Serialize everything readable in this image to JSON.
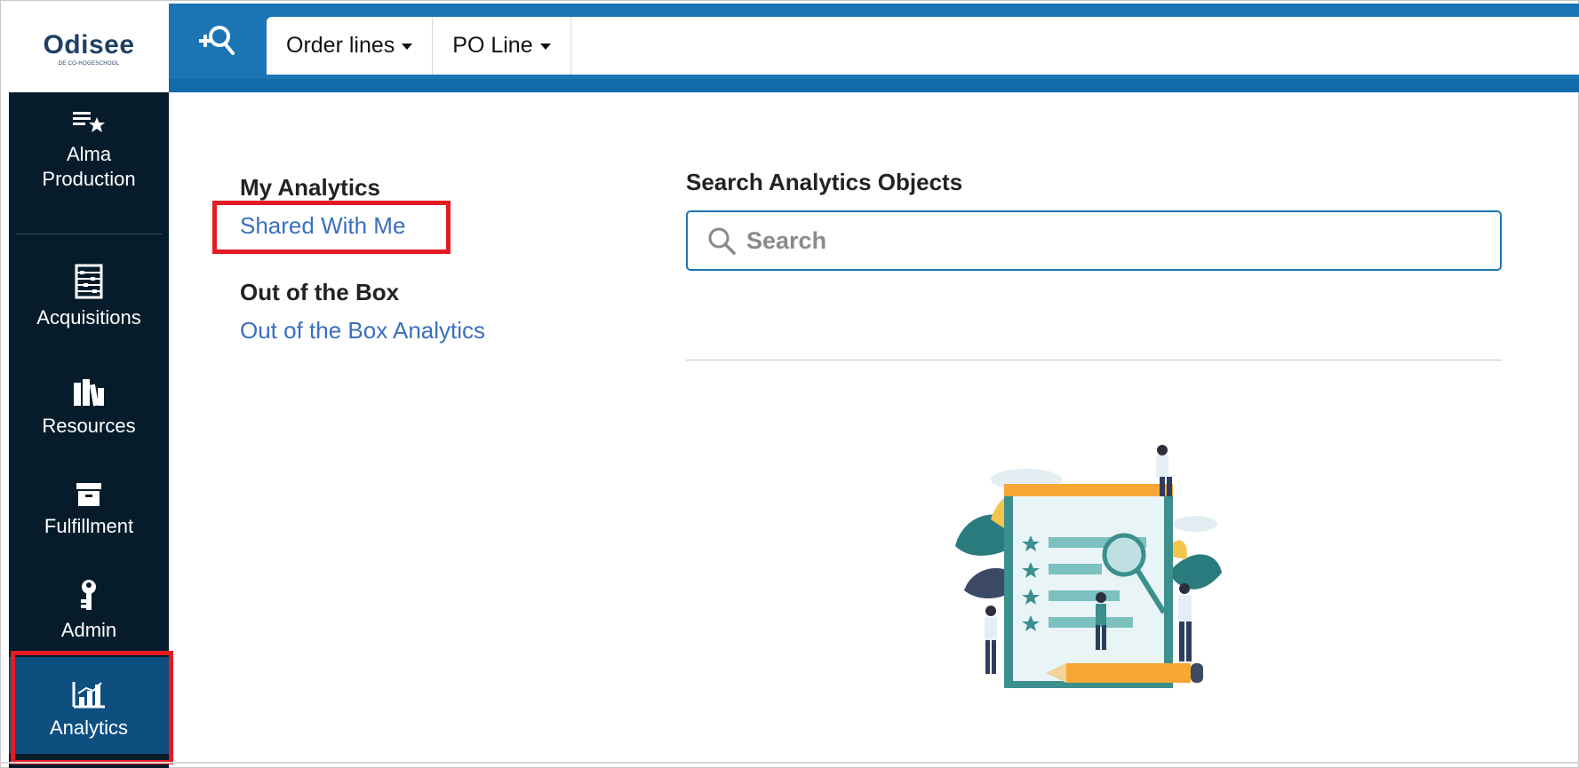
{
  "logo": {
    "name": "Odisee",
    "tagline": "DE CO-HOGESCHOOL"
  },
  "topbar": {
    "tabs": [
      {
        "label": "Order lines"
      },
      {
        "label": "PO Line"
      }
    ]
  },
  "sidebar": {
    "items": [
      {
        "label": "Alma\nProduction",
        "icon": "list-star-icon"
      },
      {
        "label": "Acquisitions",
        "icon": "abacus-icon"
      },
      {
        "label": "Resources",
        "icon": "books-icon"
      },
      {
        "label": "Fulfillment",
        "icon": "archive-box-icon"
      },
      {
        "label": "Admin",
        "icon": "key-icon"
      },
      {
        "label": "Analytics",
        "icon": "bar-chart-icon",
        "active": true
      }
    ]
  },
  "left_panel": {
    "my_analytics_title": "My Analytics",
    "shared_with_me": "Shared With Me",
    "out_of_box_title": "Out of the Box",
    "out_of_box_link": "Out of the Box Analytics"
  },
  "search": {
    "label": "Search Analytics Objects",
    "placeholder": "Search",
    "value": ""
  },
  "colors": {
    "topbar": "#1b75b5",
    "sidebar": "#071c2b",
    "active_nav": "#0e4f80",
    "link": "#3a6fc0",
    "highlight": "#e41b23"
  }
}
